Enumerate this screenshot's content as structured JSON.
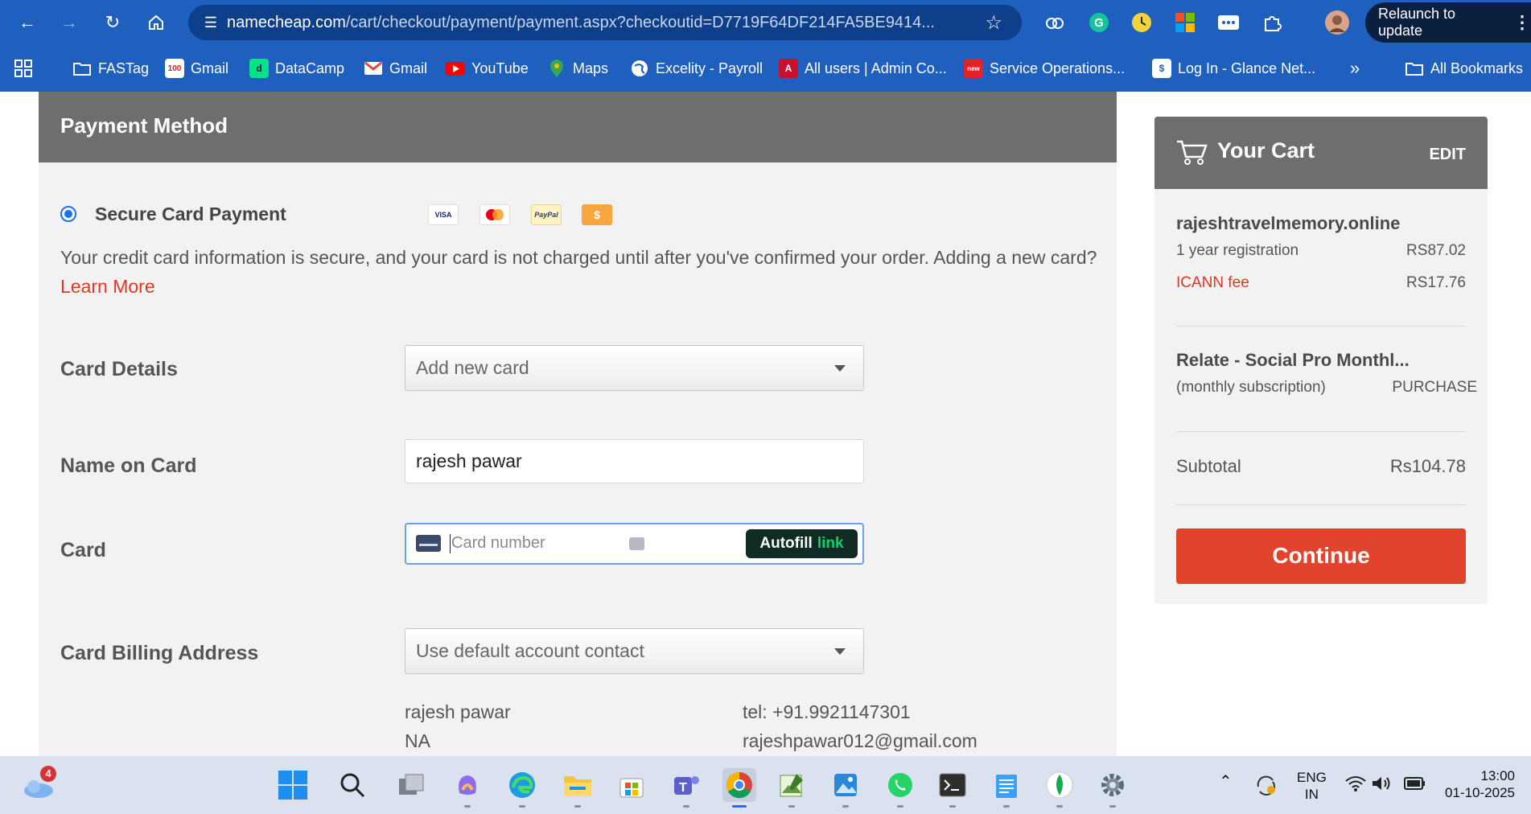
{
  "browser": {
    "url_host": "namecheap.com",
    "url_path": "/cart/checkout/payment/payment.aspx?checkoutid=D7719F64DF214FA5BE9414...",
    "relaunch_label": "Relaunch to update"
  },
  "bookmarks": [
    {
      "label": "FASTag",
      "icon": "folder-icon"
    },
    {
      "label": "Gmail",
      "icon": "hundred-icon"
    },
    {
      "label": "DataCamp",
      "icon": "datacamp-icon"
    },
    {
      "label": "Gmail",
      "icon": "gmail-icon"
    },
    {
      "label": "YouTube",
      "icon": "youtube-icon"
    },
    {
      "label": "Maps",
      "icon": "maps-icon"
    },
    {
      "label": "Excelity - Payroll",
      "icon": "globe-icon"
    },
    {
      "label": "All users | Admin Co...",
      "icon": "admin-icon"
    },
    {
      "label": "Service Operations...",
      "icon": "service-icon"
    },
    {
      "label": "Log In - Glance Net...",
      "icon": "glance-icon"
    }
  ],
  "bookmarks_all": "All Bookmarks",
  "payment": {
    "title": "Payment Method",
    "option_label": "Secure Card Payment",
    "card_logos": [
      "VISA",
      "MC",
      "PayPal",
      "$"
    ],
    "secure_text": "Your credit card information is secure, and your card is not charged until after you've confirmed your order. Adding a new card?",
    "learn_more": "Learn More",
    "card_details_label": "Card Details",
    "card_details_value": "Add new card",
    "name_label": "Name on Card",
    "name_value": "rajesh pawar",
    "card_label": "Card",
    "card_placeholder": "Card number",
    "autofill_label": "Autofill",
    "autofill_link": "link",
    "billing_label": "Card Billing Address",
    "billing_value": "Use default account contact",
    "address_name": "rajesh pawar",
    "address_line": "NA",
    "address_tel": "tel: +91.9921147301",
    "address_email": "rajeshpawar012@gmail.com"
  },
  "cart": {
    "title": "Your Cart",
    "edit": "EDIT",
    "item1_name": "rajeshtravelmemory.online",
    "item1_desc": "1 year registration",
    "item1_price": "RS87.02",
    "item1_fee_label": "ICANN fee",
    "item1_fee_price": "RS17.76",
    "item2_name": "Relate - Social Pro Monthl...",
    "item2_desc": "(monthly subscription)",
    "item2_price": "PURCHASE",
    "subtotal_label": "Subtotal",
    "subtotal_value": "Rs104.78",
    "continue_label": "Continue"
  },
  "taskbar": {
    "weather_badge": "4",
    "lang_top": "ENG",
    "lang_bottom": "IN",
    "time": "13:00",
    "date": "01-10-2025"
  }
}
